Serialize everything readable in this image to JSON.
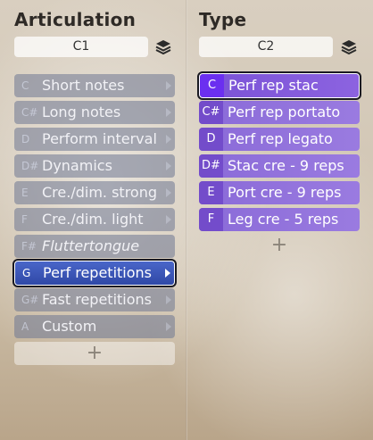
{
  "left": {
    "title": "Articulation",
    "selector_value": "C1",
    "selector_icon": "layers-icon",
    "items": [
      {
        "key": "C",
        "label": "Short notes"
      },
      {
        "key": "C#",
        "label": "Long notes"
      },
      {
        "key": "D",
        "label": "Perform interval"
      },
      {
        "key": "D#",
        "label": "Dynamics"
      },
      {
        "key": "E",
        "label": "Cre./dim. strong"
      },
      {
        "key": "F",
        "label": "Cre./dim. light"
      },
      {
        "key": "F#",
        "label": "Fluttertongue"
      },
      {
        "key": "G",
        "label": "Perf repetitions"
      },
      {
        "key": "G#",
        "label": "Fast repetitions"
      },
      {
        "key": "A",
        "label": "Custom"
      }
    ],
    "selected_index": 7,
    "add_label": "+"
  },
  "right": {
    "title": "Type",
    "selector_value": "C2",
    "selector_icon": "layers-icon",
    "items": [
      {
        "key": "C",
        "label": "Perf rep stac"
      },
      {
        "key": "C#",
        "label": "Perf rep portato"
      },
      {
        "key": "D",
        "label": "Perf rep legato"
      },
      {
        "key": "D#",
        "label": "Stac cre - 9 reps"
      },
      {
        "key": "E",
        "label": "Port cre - 9 reps"
      },
      {
        "key": "F",
        "label": "Leg cre - 5 reps"
      }
    ],
    "selected_index": 0,
    "add_label": "+"
  },
  "colors": {
    "selected_blue": "#3f5bbf",
    "purple": "#8f6fdc",
    "key_purple": "#6b2ff0"
  }
}
